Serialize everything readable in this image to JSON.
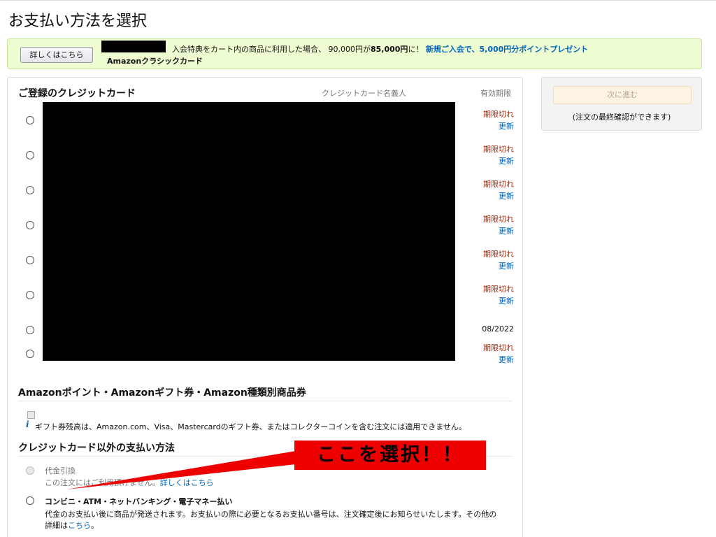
{
  "page": {
    "title": "お支払い方法を選択"
  },
  "banner": {
    "button_label": "詳しくはこちら",
    "text_before": "入会特典をカート内の商品に利用した場合、 90,000円が",
    "price_bold": "85,000円",
    "text_after": "に！",
    "link_text": "新規ご入会で、5,000円分ポイントプレゼント",
    "card_name": "Amazonクラシックカード"
  },
  "credit_cards": {
    "section_title": "ご登録のクレジットカード",
    "col_name": "クレジットカード名義人",
    "col_expiry": "有効期限",
    "rows": [
      {
        "expired": "期限切れ",
        "update": "更新"
      },
      {
        "expired": "期限切れ",
        "update": "更新"
      },
      {
        "expired": "期限切れ",
        "update": "更新"
      },
      {
        "expired": "期限切れ",
        "update": "更新"
      },
      {
        "expired": "期限切れ",
        "update": "更新"
      },
      {
        "expired": "期限切れ",
        "update": "更新"
      },
      {
        "date": "08/2022"
      },
      {
        "expired": "期限切れ",
        "update": "更新"
      }
    ]
  },
  "points": {
    "section_title": "Amazonポイント・Amazonギフト券・Amazon種類別商品券",
    "info_icon": "i",
    "info_text": "ギフト券残高は、Amazon.com、Visa、Mastercardのギフト券、またはコレクターコインを含む注文には適用できません。"
  },
  "other": {
    "section_title": "クレジットカード以外の支払い方法",
    "cod_label": "代金引換",
    "cod_sub": "この注文にはご利用頂けません。",
    "cod_link": "詳しくはこちら",
    "conv_label": "コンビニ・ATM・ネットバンキング・電子マネー払い",
    "conv_desc": "代金のお支払い後に商品が発送されます。お支払いの際に必要となるお支払い番号は、注文確定後にお知らせいたします。その他の",
    "conv_desc2": "詳細は",
    "conv_link": "こちら",
    "conv_desc3": "。"
  },
  "sidebar": {
    "next_button": "次に進む",
    "note": "(注文の最終確認ができます)"
  },
  "annotation": {
    "callout_text": "ここを選択！！",
    "color": "#ee0000"
  },
  "colors": {
    "banner_bg": "#eefcd2",
    "expired": "#b12704",
    "link": "#0066c0"
  }
}
